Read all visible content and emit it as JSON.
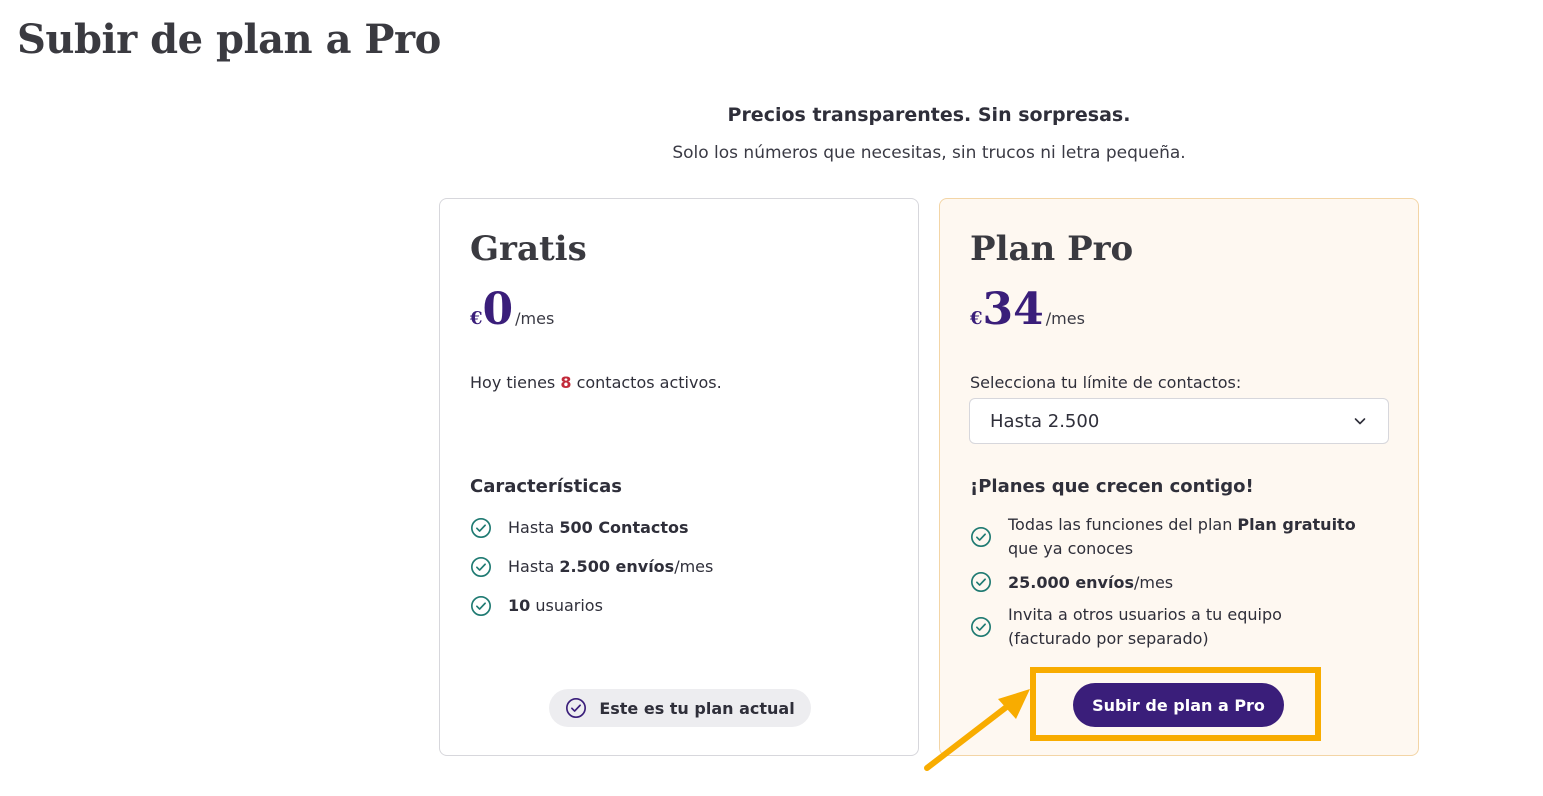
{
  "page": {
    "title": "Subir de plan a Pro"
  },
  "intro": {
    "tagline": "Precios transparentes. Sin sorpresas.",
    "subtagline": "Solo los números que necesitas, sin trucos ni letra pequeña."
  },
  "plans": {
    "free": {
      "name": "Gratis",
      "currency": "€",
      "amount": "0",
      "period": "/mes",
      "contacts_prefix": "Hoy tienes ",
      "contacts_count": "8",
      "contacts_suffix": " contactos activos.",
      "features_title": "Características",
      "features": [
        {
          "pre": "Hasta ",
          "bold": "500 Contactos",
          "post": ""
        },
        {
          "pre": "Hasta ",
          "bold": "2.500 envíos",
          "post": "/mes"
        },
        {
          "pre": "",
          "bold": "10",
          "post": " usuarios"
        }
      ],
      "current_label": "Este es tu plan actual"
    },
    "pro": {
      "name": "Plan Pro",
      "currency": "€",
      "amount": "34",
      "period": "/mes",
      "select_label": "Selecciona tu límite de contactos:",
      "select_value": "Hasta 2.500",
      "features_title": "¡Planes que crecen contigo!",
      "features": [
        {
          "pre": "Todas las funciones del plan ",
          "bold": "Plan gratuito",
          "post": " que ya conoces"
        },
        {
          "pre": "",
          "bold": "25.000 envíos",
          "post": "/mes"
        },
        {
          "pre": "Invita a otros usuarios a tu equipo (facturado por separado)",
          "bold": "",
          "post": ""
        }
      ],
      "upgrade_label": "Subir de plan a Pro"
    }
  },
  "colors": {
    "brand": "#3a1e7a",
    "check": "#1f7a72",
    "highlight": "#f8ac00",
    "count": "#c22a3a",
    "pro_bg": "#fef8f1"
  },
  "icons": {
    "feature": "check-circle-icon",
    "select": "chevron-down-icon",
    "current": "check-circle-icon",
    "annotation": "arrow-icon"
  }
}
